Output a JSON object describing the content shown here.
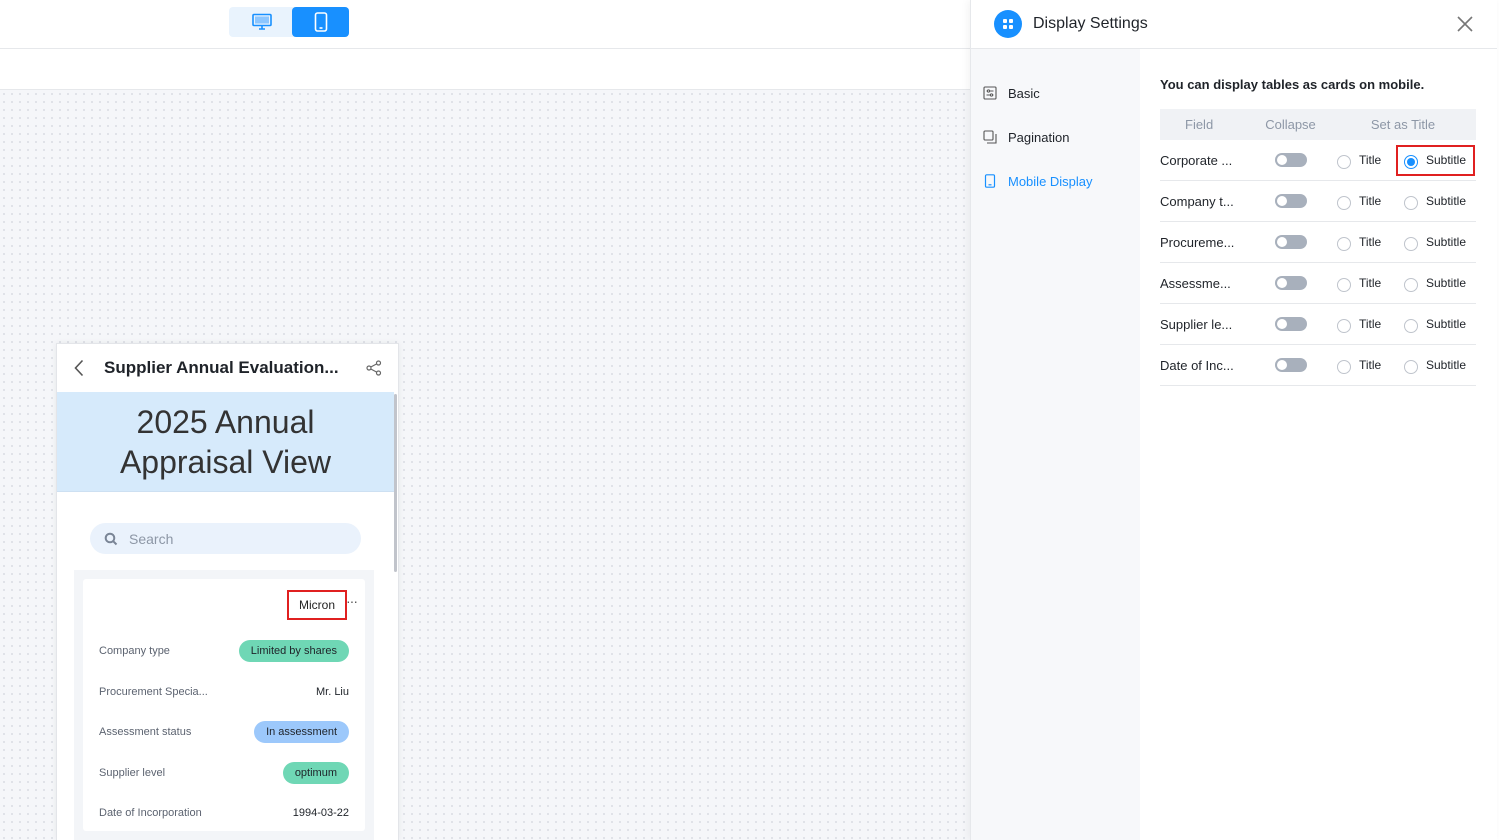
{
  "toolbar": {
    "desktop_icon": "desktop-icon",
    "mobile_icon": "mobile-icon",
    "active": "mobile"
  },
  "phone": {
    "title": "Supplier Annual Evaluation...",
    "banner": [
      "2025 Annual",
      "Appraisal View"
    ],
    "search_placeholder": "Search",
    "card": {
      "subtitle": "Micron",
      "more": "···",
      "rows": [
        {
          "label": "Company type",
          "value": "Limited by shares",
          "style": "green"
        },
        {
          "label": "Procurement Specia...",
          "value": "Mr. Liu",
          "style": "plain"
        },
        {
          "label": "Assessment status",
          "value": "In assessment",
          "style": "blue"
        },
        {
          "label": "Supplier level",
          "value": "optimum",
          "style": "green"
        },
        {
          "label": "Date of Incorporation",
          "value": "1994-03-22",
          "style": "plain"
        }
      ]
    }
  },
  "panel": {
    "title": "Display Settings",
    "nav": [
      {
        "label": "Basic",
        "icon": "basic-settings-icon",
        "active": false
      },
      {
        "label": "Pagination",
        "icon": "pagination-icon",
        "active": false
      },
      {
        "label": "Mobile Display",
        "icon": "mobile-display-icon",
        "active": true
      }
    ],
    "intro": "You can display tables as cards on mobile.",
    "columns": {
      "field": "Field",
      "collapse": "Collapse",
      "set_as_title": "Set as Title"
    },
    "title_option": "Title",
    "subtitle_option": "Subtitle",
    "rows": [
      {
        "field": "Corporate ...",
        "collapse": false,
        "selected": "subtitle"
      },
      {
        "field": "Company t...",
        "collapse": false,
        "selected": "none"
      },
      {
        "field": "Procureme...",
        "collapse": false,
        "selected": "none"
      },
      {
        "field": "Assessme...",
        "collapse": false,
        "selected": "none"
      },
      {
        "field": "Supplier le...",
        "collapse": false,
        "selected": "none"
      },
      {
        "field": "Date of Inc...",
        "collapse": false,
        "selected": "none"
      }
    ],
    "accent_color": "#1890ff",
    "highlight_color": "#e02020"
  }
}
